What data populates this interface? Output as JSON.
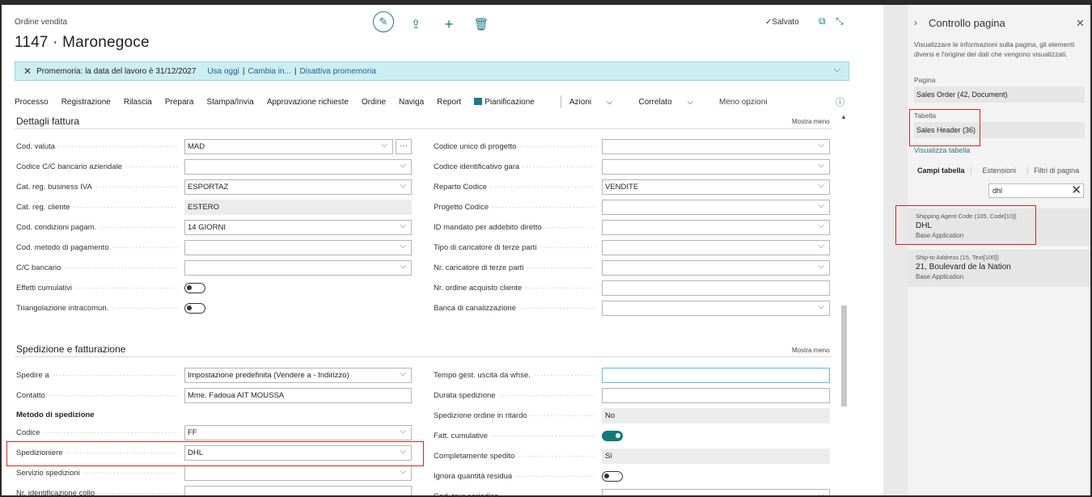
{
  "page": {
    "breadcrumb": "Ordine vendita",
    "title": "1147 · Maronegoce",
    "saved_status": "Salvato"
  },
  "banner": {
    "text": "Promemoria: la data del lavoro è 31/12/2027",
    "links": [
      "Usa oggi",
      "Cambia in...",
      "Disattiva promemoria"
    ]
  },
  "menu": {
    "items": [
      "Processo",
      "Registrazione",
      "Rilascia",
      "Prepara",
      "Stampa/Invia",
      "Approvazione richieste",
      "Ordine",
      "Naviga",
      "Report",
      "Pianificazione",
      "Azioni",
      "Correlato",
      "Meno opzioni"
    ]
  },
  "sections": {
    "invoice": {
      "title": "Dettagli fattura",
      "toggle_label": "Mostra meno"
    },
    "shipping": {
      "title": "Spedizione e fatturazione",
      "toggle_label": "Mostra meno",
      "subheading": "Metodo di spedizione"
    }
  },
  "invoice_left": [
    {
      "label": "Cod. valuta",
      "value": "MAD"
    },
    {
      "label": "Codice C/C bancario aziendale",
      "value": ""
    },
    {
      "label": "Cat. reg. business IVA",
      "value": "ESPORTAZ"
    },
    {
      "label": "Cat. reg. cliente",
      "value": "ESTERO"
    },
    {
      "label": "Cod. condizioni pagam.",
      "value": "14 GIORNI"
    },
    {
      "label": "Cod. metodo di pagamento",
      "value": ""
    },
    {
      "label": "C/C bancario",
      "value": ""
    },
    {
      "label": "Effetti cumulativi",
      "value": "off"
    },
    {
      "label": "Triangolazione intracomun.",
      "value": "off"
    }
  ],
  "invoice_right": [
    {
      "label": "Codice unico di progetto",
      "value": ""
    },
    {
      "label": "Codice identificativo gara",
      "value": ""
    },
    {
      "label": "Reparto Codice",
      "value": "VENDITE"
    },
    {
      "label": "Progetto Codice",
      "value": ""
    },
    {
      "label": "ID mandato per addebito diretto",
      "value": ""
    },
    {
      "label": "Tipo di caricatore di terze parti",
      "value": ""
    },
    {
      "label": "Nr. caricatore di terze parti",
      "value": ""
    },
    {
      "label": "Nr. ordine acquisto cliente",
      "value": ""
    },
    {
      "label": "Banca di canalizzazione",
      "value": ""
    }
  ],
  "shipping_left": [
    {
      "label": "Spedire a",
      "value": "Impostazione predefinita (Vendere a - Indirizzo)"
    },
    {
      "label": "Contatto",
      "value": "Mme. Fadoua AIT MOUSSA"
    },
    {
      "label": "Codice",
      "value": "FF"
    },
    {
      "label": "Spedizioniere",
      "value": "DHL"
    },
    {
      "label": "Servizio spedizioni",
      "value": ""
    },
    {
      "label": "Nr. identificazione collo",
      "value": ""
    }
  ],
  "shipping_right": [
    {
      "label": "Tempo gest. uscita da whse.",
      "value": ""
    },
    {
      "label": "Durata spedizione",
      "value": ""
    },
    {
      "label": "Spedizione ordine in ritardo",
      "value": "No"
    },
    {
      "label": "Fatt. cumulative",
      "value": "on"
    },
    {
      "label": "Completamente spedito",
      "value": "Sì"
    },
    {
      "label": "Ignora quantità residua",
      "value": "off"
    },
    {
      "label": "Cod. tour periodico",
      "value": ""
    }
  ],
  "panel": {
    "title": "Controllo pagina",
    "description": "Visualizzare le informazioni sulla pagina, gli elementi diversi e l'origine dei dati che vengono visualizzati.",
    "page_label": "Pagina",
    "page_value": "Sales Order (42, Document)",
    "table_label": "Tabella",
    "table_value": "Sales Header (36)",
    "view_table_link": "Visualizza tabella",
    "tabs": [
      "Campi tabella",
      "Estensioni",
      "Filtri di pagina"
    ],
    "search_value": "dhl",
    "results": [
      {
        "field": "Shipping Agent Code (105, Code[10])",
        "value": "DHL",
        "source": "Base Application"
      },
      {
        "field": "Ship-to Address (15, Text[100])",
        "value": "21, Boulevard de la Nation",
        "source": "Base Application"
      }
    ]
  },
  "colors": {
    "accent": "#1d7a83",
    "banner_bg": "#cdeef0",
    "highlight": "#e02020",
    "toggle_on": "#0f7c7a"
  },
  "icons": [
    "edit-icon",
    "share-icon",
    "add-icon",
    "delete-icon",
    "checkmark-icon",
    "open-new-icon",
    "collapse-icon",
    "close-icon",
    "chevron-down-icon",
    "info-icon",
    "chevron-right-icon",
    "ellipsis-icon"
  ]
}
